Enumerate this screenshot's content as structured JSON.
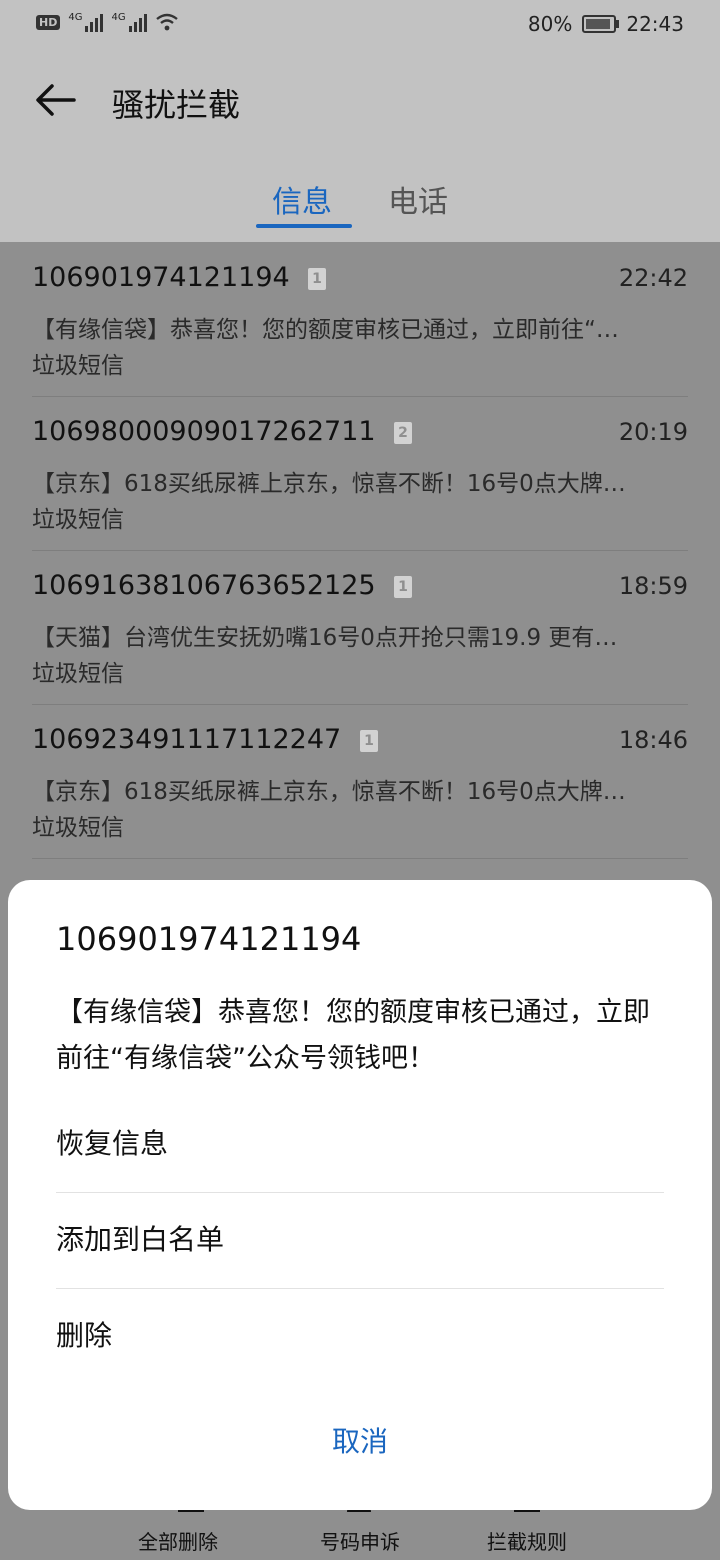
{
  "status_bar": {
    "hd": "HD",
    "network1": "4G",
    "network2": "4G",
    "battery": "80%",
    "time": "22:43"
  },
  "header": {
    "back_icon": "back-arrow-icon",
    "title": "骚扰拦截",
    "tabs": [
      {
        "label": "信息",
        "active": true
      },
      {
        "label": "电话",
        "active": false
      }
    ]
  },
  "messages": [
    {
      "number": "106901974121194",
      "sim": "1",
      "time": "22:42",
      "preview": "【有缘信袋】恭喜您！您的额度审核已通过，立即前往“…",
      "tag": "垃圾短信"
    },
    {
      "number": "1069800090901726271​1",
      "sim": "2",
      "time": "20:19",
      "preview": "【京东】618买纸尿裤上京东，惊喜不断！16号0点大牌…",
      "tag": "垃圾短信"
    },
    {
      "number": "106916381067636521​25",
      "sim": "1",
      "time": "18:59",
      "preview": "【天猫】台湾优生安抚奶嘴16号0点开抢只需19.9 更有…",
      "tag": "垃圾短信"
    },
    {
      "number": "106923491117112247",
      "sim": "1",
      "time": "18:46",
      "preview": "【京东】618买纸尿裤上京东，惊喜不断！16号0点大牌…",
      "tag": "垃圾短信"
    }
  ],
  "bottom_nav": {
    "items": [
      {
        "label": "全部删除",
        "icon": "delete-all-icon"
      },
      {
        "label": "号码申诉",
        "icon": "appeal-icon"
      },
      {
        "label": "拦截规则",
        "icon": "rules-icon"
      }
    ]
  },
  "sheet": {
    "number": "106901974121194",
    "body": "【有缘信袋】恭喜您！您的额度审核已通过，立即前往“有缘信袋”公众号领钱吧！",
    "actions": [
      "恢复信息",
      "添加到白名单",
      "删除"
    ],
    "cancel": "取消"
  },
  "colors": {
    "accent": "#1a66bf",
    "scrim": "#8f8f8f",
    "header_bg": "#c2c2c2"
  }
}
